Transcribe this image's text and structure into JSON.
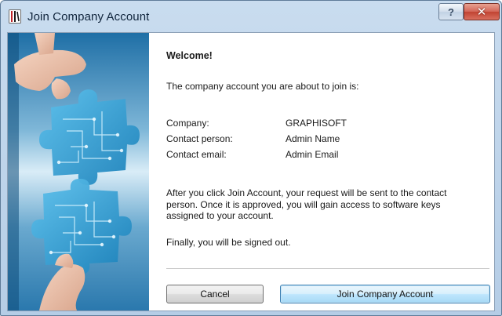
{
  "window": {
    "title": "Join Company Account",
    "help_label": "?",
    "close_label": "✕"
  },
  "dialog": {
    "welcome": "Welcome!",
    "intro": "The company account you are about to join is:",
    "fields": [
      {
        "label": "Company:",
        "value": "GRAPHISOFT"
      },
      {
        "label": "Contact person:",
        "value": "Admin Name"
      },
      {
        "label": "Contact email:",
        "value": "Admin Email"
      }
    ],
    "info": "After you click Join Account, your request will be sent to the contact person. Once it is approved, you will gain access to software keys assigned to your account.",
    "signout_note": "Finally, you will be signed out."
  },
  "buttons": {
    "cancel_label": "Cancel",
    "join_label": "Join Company Account"
  },
  "icons": {
    "app": "archicad-app-icon",
    "help": "question-mark-icon",
    "close": "close-icon"
  },
  "colors": {
    "title_bar": "#c9dcef",
    "close_button": "#c14332",
    "default_button": "#bee6fd",
    "illustration_blue": "#2a8fc4"
  }
}
